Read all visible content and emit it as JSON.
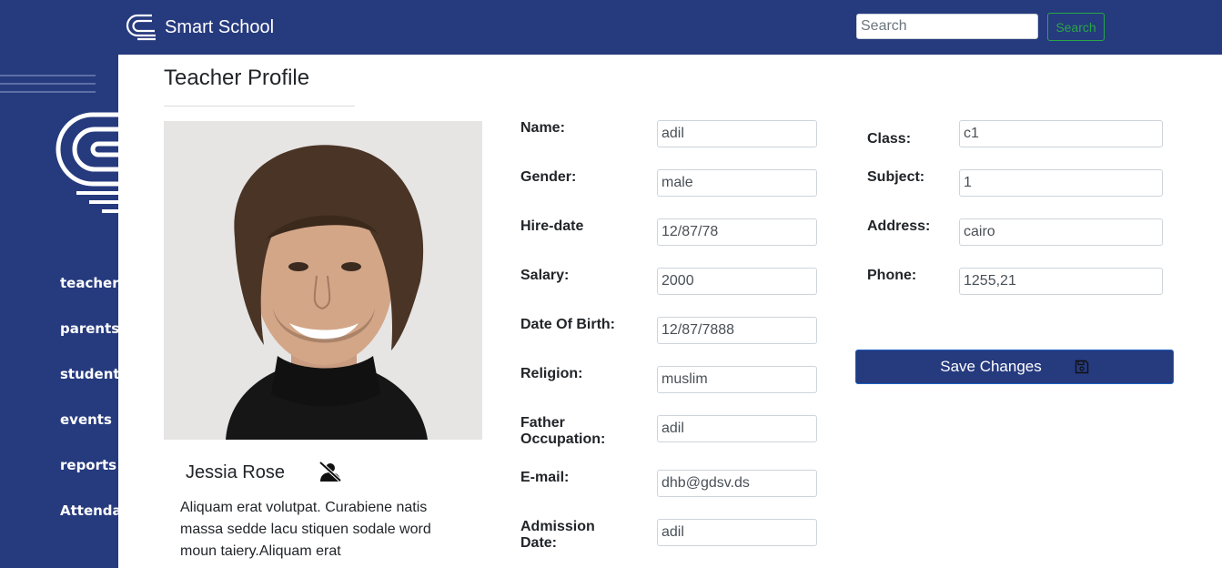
{
  "header": {
    "brand_name": "Smart School",
    "search_placeholder": "Search",
    "search_button": "Search"
  },
  "sidebar": {
    "items": [
      {
        "label": "teachers"
      },
      {
        "label": "parents"
      },
      {
        "label": "students"
      },
      {
        "label": "events"
      },
      {
        "label": "reports"
      },
      {
        "label": "Attendance"
      }
    ]
  },
  "profile": {
    "title": "Teacher Profile",
    "name": "Jessia Rose",
    "bio": "Aliquam erat volutpat. Curabiene natis massa sedde lacu stiquen sodale word moun taiery.Aliquam erat"
  },
  "form": {
    "left": [
      {
        "label": "Name:",
        "value": "adil"
      },
      {
        "label": "Gender:",
        "value": "male"
      },
      {
        "label": "Hire-date",
        "value": "12/87/78"
      },
      {
        "label": "Salary:",
        "value": "2000"
      },
      {
        "label": "Date Of Birth:",
        "value": "12/87/7888"
      },
      {
        "label": "Religion:",
        "value": "muslim"
      },
      {
        "label": "Father Occupation:",
        "value": "adil"
      },
      {
        "label": "E-mail:",
        "value": "dhb@gdsv.ds"
      },
      {
        "label": "Admission Date:",
        "value": "adil"
      }
    ],
    "right": [
      {
        "label": "Class:",
        "value": "c1"
      },
      {
        "label": "Subject:",
        "value": "1"
      },
      {
        "label": "Address:",
        "value": "cairo"
      },
      {
        "label": "Phone:",
        "value": "1255,21"
      }
    ],
    "save_label": "Save Changes"
  },
  "colors": {
    "navy": "#263a7e",
    "search_green": "#28a745",
    "save_border": "#1d62c4"
  }
}
